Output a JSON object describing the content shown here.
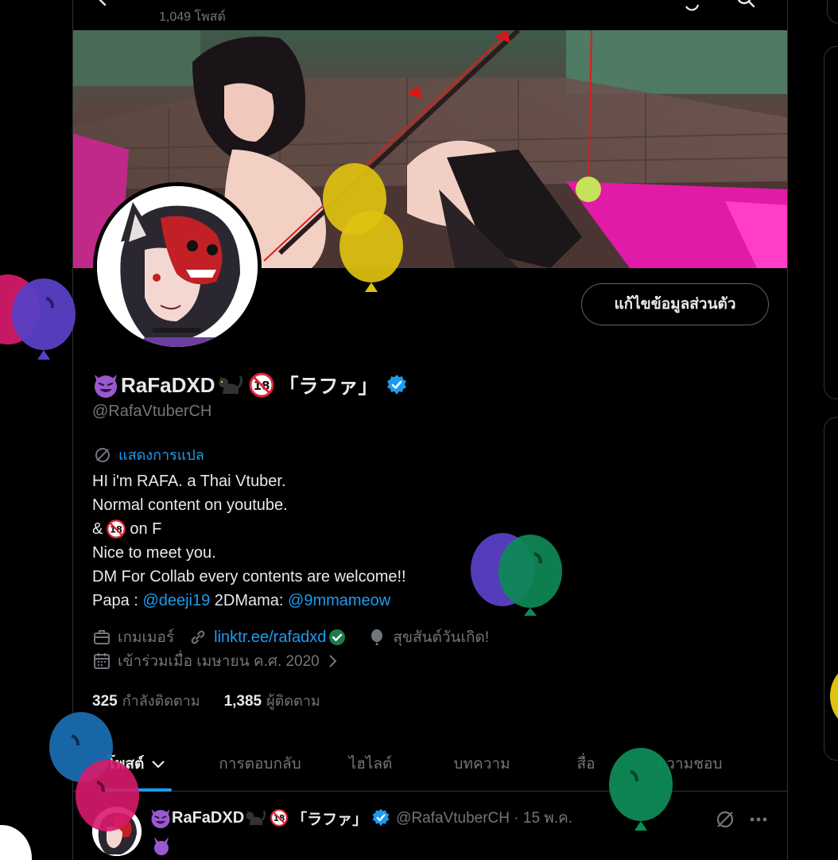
{
  "header": {
    "posts_count": "1,049 โพสต์"
  },
  "profile": {
    "display_name": "RaFaDXD",
    "display_suffix": "「ラファ」",
    "handle": "@RafaVtuberCH",
    "edit_button_label": "แก้ไขข้อมูลส่วนตัว",
    "translate_label": "แสดงการแปล",
    "bio": {
      "line1": "HI i'm RAFA. a Thai Vtuber.",
      "line2": "Normal content on youtube.",
      "line3_prefix": "&",
      "line3_suffix": "on F",
      "line4": "Nice to meet you.",
      "line5": "DM For Collab every contents are welcome!!",
      "line6_papa": "Papa :",
      "line6_papa_link": "@deeji19",
      "line6_mama": "2DMama:",
      "line6_mama_link": "@9mmameow"
    },
    "category": "เกมเมอร์",
    "website": "linktr.ee/rafadxd",
    "birthday": "สุขสันต์วันเกิด!",
    "joined": "เข้าร่วมเมื่อ เมษายน ค.ศ. 2020",
    "following_count": "325",
    "following_label": "กำลังติดตาม",
    "followers_count": "1,385",
    "followers_label": "ผู้ติดตาม"
  },
  "tabs": [
    {
      "label": "โพสต์"
    },
    {
      "label": "การตอบกลับ"
    },
    {
      "label": "ไฮไลต์"
    },
    {
      "label": "บทความ"
    },
    {
      "label": "สื่อ"
    },
    {
      "label": "ความชอบ"
    }
  ],
  "post": {
    "name": "RaFaDXD",
    "suffix": "「ラファ」",
    "handle_date": "@RafaVtuberCH · 15 พ.ค."
  },
  "icons": {
    "back": "arrow-left-icon",
    "retweet": "retweet-icon",
    "search": "search-icon",
    "translate": "translate-icon",
    "briefcase": "briefcase-icon",
    "link": "link-icon",
    "balloon": "balloon-icon",
    "calendar": "calendar-icon",
    "verified": "verified-badge-icon",
    "more": "more-icon"
  },
  "colors": {
    "accent": "#1d9bf0",
    "text_primary": "#e7e9ea",
    "text_secondary": "#71767b",
    "border": "#2f3336",
    "background": "#000000"
  }
}
